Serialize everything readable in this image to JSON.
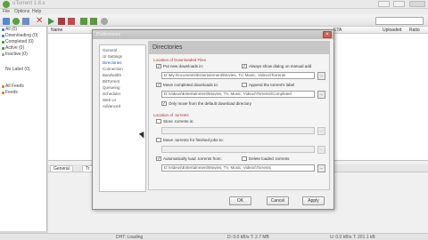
{
  "window": {
    "title": "uTorrent 1.8.x"
  },
  "menu": [
    "File",
    "Options",
    "Help"
  ],
  "sidebar": {
    "items": [
      {
        "label": "All (0)",
        "color": "#3a7bd5"
      },
      {
        "label": "Downloading (0)",
        "color": "#3a7bd5"
      },
      {
        "label": "Completed (0)",
        "color": "#3a9a3a"
      },
      {
        "label": "Active (0)",
        "color": "#3a9a3a"
      },
      {
        "label": "Inactive (0)",
        "color": "#9a9a9a"
      },
      {
        "label": "No Label (0)",
        "color": "#9a9a9a"
      },
      {
        "label": "All Feeds",
        "color": "#e07b2a"
      },
      {
        "label": "Feeds",
        "color": "#e07b2a"
      }
    ]
  },
  "list": {
    "columns": [
      "Name",
      "ETA",
      "Uploaded",
      "Ratio"
    ]
  },
  "bottom_tabs": [
    "General",
    "Tr"
  ],
  "statusbar": {
    "left": "DHT: Loading",
    "middle": "D: 0.0 kB/s T: 2.7 MB",
    "right": "U: 0.0 kB/s T: 201.1 kB"
  },
  "dialog": {
    "title": "Preferences",
    "close": "×",
    "categories": [
      "General",
      "UI Settings",
      "Directories",
      "Connection",
      "Bandwidth",
      "BitTorrent",
      "Queueing",
      "Scheduler",
      "Web UI",
      "Advanced"
    ],
    "selected_category": "Directories",
    "panel_title": "Directories",
    "sections": {
      "downloaded_title": "Location of Downloaded Files",
      "new_downloads_label": "Put new downloads in:",
      "always_show_label": "Always show dialog on manual add",
      "new_downloads_path": "D:\\My Documents\\Entertainment\\Movies, TV, Music, Videos\\Torrents",
      "move_completed_label": "Move completed downloads to:",
      "append_label": "Append the torrent's label",
      "move_completed_path": "D:\\Videos\\Entertainment\\Movies, TV, Music, Videos\\Torrents\\Completed",
      "only_move_label": "Only move from the default download directory",
      "torrents_title": "Location of .torrents",
      "store_torrents_label": "Store .torrents in:",
      "move_finished_label": "Move .torrents for finished jobs to:",
      "autoload_label": "Automatically load .torrents from:",
      "delete_loaded_label": "Delete loaded .torrents",
      "autoload_path": "D:\\Videos\\Entertainment\\Movies, TV, Music, Videos\\Torrents"
    },
    "browse_label": "...",
    "buttons": {
      "ok": "OK",
      "cancel": "Cancel",
      "apply": "Apply"
    }
  }
}
